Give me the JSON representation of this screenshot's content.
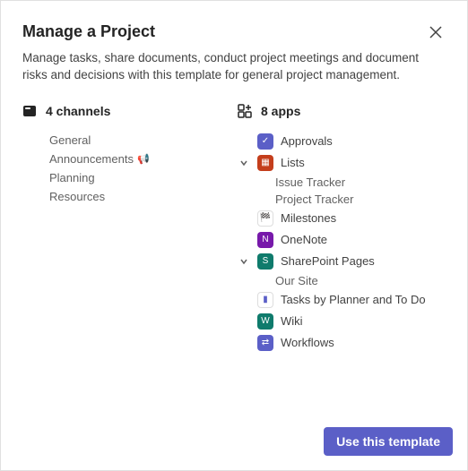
{
  "header": {
    "title": "Manage a Project",
    "description": "Manage tasks, share documents, conduct project meetings and document risks and decisions with this template for general project management."
  },
  "channels": {
    "heading": "4 channels",
    "items": [
      {
        "label": "General",
        "emoji": ""
      },
      {
        "label": "Announcements",
        "emoji": "📢"
      },
      {
        "label": "Planning",
        "emoji": ""
      },
      {
        "label": "Resources",
        "emoji": ""
      }
    ]
  },
  "apps": {
    "heading": "8 apps",
    "items": [
      {
        "label": "Approvals",
        "icon_bg": "#5b5fc7",
        "icon_glyph": "✓",
        "expandable": false
      },
      {
        "label": "Lists",
        "icon_bg": "#c43e1c",
        "icon_glyph": "▦",
        "expandable": true,
        "children": [
          "Issue Tracker",
          "Project Tracker"
        ]
      },
      {
        "label": "Milestones",
        "icon_bg": "#ffffff",
        "icon_glyph": "🏁",
        "icon_fg": "#c43e1c",
        "expandable": false
      },
      {
        "label": "OneNote",
        "icon_bg": "#7719aa",
        "icon_glyph": "N",
        "expandable": false
      },
      {
        "label": "SharePoint Pages",
        "icon_bg": "#0f7b6c",
        "icon_glyph": "S",
        "expandable": true,
        "children": [
          "Our Site"
        ]
      },
      {
        "label": "Tasks by Planner and To Do",
        "icon_bg": "#ffffff",
        "icon_glyph": "▮",
        "icon_fg": "#5b5fc7",
        "expandable": false
      },
      {
        "label": "Wiki",
        "icon_bg": "#0f7b6c",
        "icon_glyph": "W",
        "expandable": false
      },
      {
        "label": "Workflows",
        "icon_bg": "#5b5fc7",
        "icon_glyph": "⇄",
        "expandable": false
      }
    ]
  },
  "footer": {
    "button_label": "Use this template"
  }
}
